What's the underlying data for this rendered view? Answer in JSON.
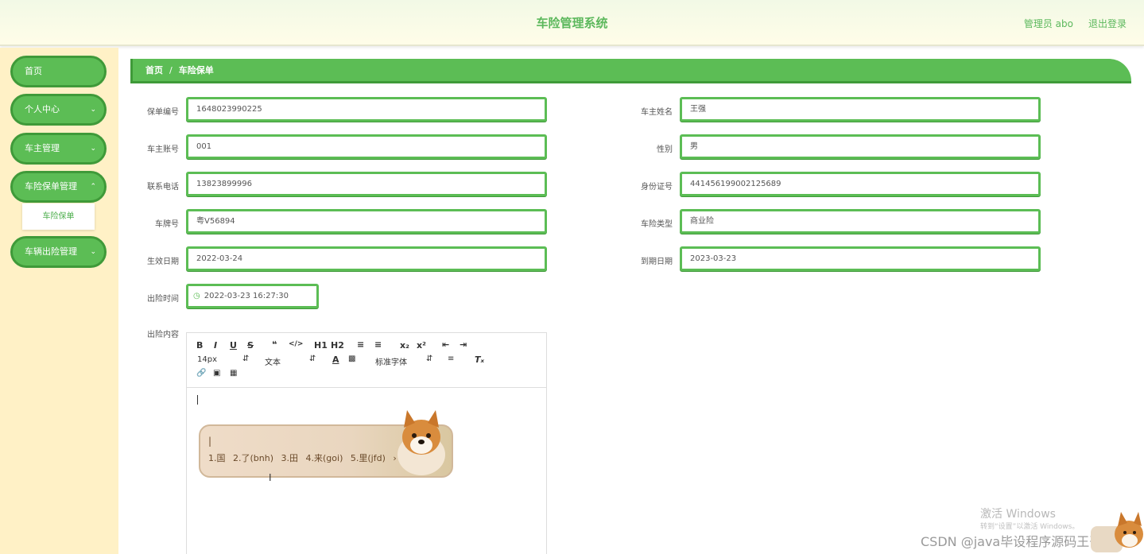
{
  "header": {
    "title": "车险管理系统",
    "user": "管理员 abo",
    "logout": "退出登录"
  },
  "sidebar": {
    "items": [
      {
        "label": "首页"
      },
      {
        "label": "个人中心"
      },
      {
        "label": "车主管理"
      },
      {
        "label": "车险保单管理"
      },
      {
        "label": "车辆出险管理"
      }
    ],
    "sub_item": "车险保单"
  },
  "breadcrumb": {
    "home": "首页",
    "separator": "/",
    "current": "车险保单"
  },
  "form": {
    "policy_no_label": "保单编号",
    "policy_no": "1648023990225",
    "owner_name_label": "车主姓名",
    "owner_name": "王强",
    "owner_account_label": "车主账号",
    "owner_account": "001",
    "gender_label": "性别",
    "gender": "男",
    "phone_label": "联系电话",
    "phone": "13823899996",
    "id_card_label": "身份证号",
    "id_card": "441456199002125689",
    "plate_label": "车牌号",
    "plate": "粤V56894",
    "insurance_type_label": "车险类型",
    "insurance_type": "商业险",
    "start_date_label": "生效日期",
    "start_date": "2022-03-24",
    "end_date_label": "到期日期",
    "end_date": "2023-03-23",
    "incident_time_label": "出险时间",
    "incident_time": "2022-03-23 16:27:30",
    "incident_content_label": "出险内容"
  },
  "editor": {
    "font_size": "14px",
    "block_type": "文本",
    "font_family": "标准字体",
    "h1": "H1",
    "h2": "H2"
  },
  "ime": {
    "candidates": [
      "1.国",
      "2.了(bnh)",
      "3.田",
      "4.来(goi)",
      "5.里(jfd)"
    ]
  },
  "watermarks": {
    "activate": "激活 Windows",
    "activate_hint": "转到“设置”以激活 Windows。",
    "csdn": "CSDN @java毕设程序源码王哥"
  }
}
